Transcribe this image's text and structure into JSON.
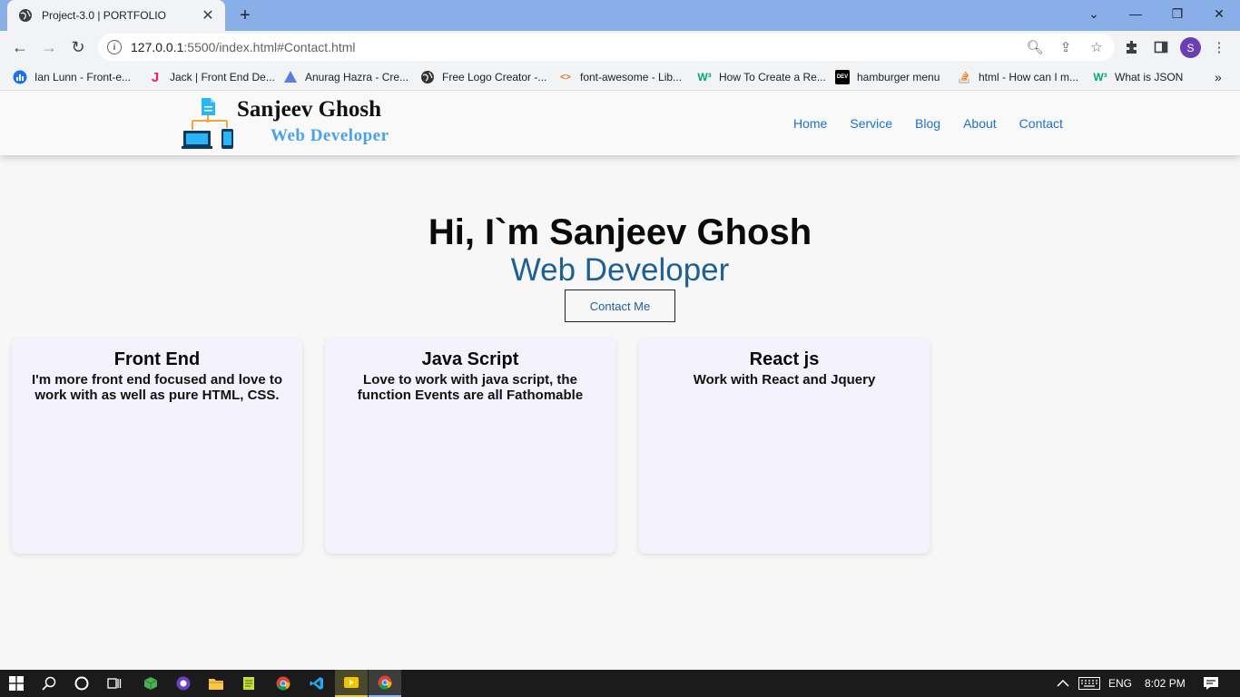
{
  "browser": {
    "tab": {
      "title": "Project-3.0 | PORTFOLIO"
    },
    "url": {
      "host": "127.0.0.1",
      "path": ":5500/index.html#Contact.html"
    },
    "profile_initial": "S",
    "bookmarks": [
      {
        "label": "Ian Lunn - Front-e...",
        "icon": "chart-icon",
        "color": "#1a73e8"
      },
      {
        "label": "Jack | Front End De...",
        "icon": "j-icon",
        "color": "#e91e63"
      },
      {
        "label": "Anurag Hazra - Cre...",
        "icon": "triangle-icon",
        "color": "#5b7fe0"
      },
      {
        "label": "Free Logo Creator -...",
        "icon": "globe-icon",
        "color": "#333333"
      },
      {
        "label": "font-awesome - Lib...",
        "icon": "code-icon",
        "color": "#e8710a"
      },
      {
        "label": "How To Create a Re...",
        "icon": "w3-icon",
        "color": "#04aa6d"
      },
      {
        "label": "hamburger menu",
        "icon": "dev-icon",
        "color": "#000000"
      },
      {
        "label": "html - How can I m...",
        "icon": "stack-icon",
        "color": "#f48024"
      },
      {
        "label": "What is JSON",
        "icon": "w3-icon",
        "color": "#04aa6d"
      }
    ]
  },
  "site": {
    "logo": {
      "name": "Sanjeev Ghosh",
      "role": "Web Developer"
    },
    "nav": [
      "Home",
      "Service",
      "Blog",
      "About",
      "Contact"
    ],
    "hero": {
      "title": "Hi, I`m Sanjeev Ghosh",
      "subtitle": "Web Developer",
      "button": "Contact Me"
    },
    "cards": [
      {
        "title": "Front End",
        "text": "I'm more front end focused and love to work with as well as pure HTML, CSS."
      },
      {
        "title": "Java Script",
        "text": "Love to work with java script, the function Events are all Fathomable"
      },
      {
        "title": "React js",
        "text": "Work with React and Jquery"
      }
    ]
  },
  "taskbar": {
    "language": "ENG",
    "time": "8:02 PM"
  },
  "colors": {
    "accent": "#1a73c9",
    "subtitle": "#1e5f94",
    "logo_role": "#4aa3e6",
    "card_bg": "#f4f2fd"
  }
}
